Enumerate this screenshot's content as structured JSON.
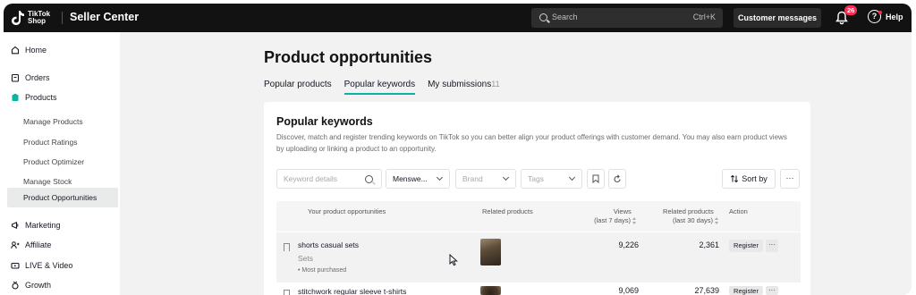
{
  "topbar": {
    "logo_text_line1": "TikTok",
    "logo_text_line2": "Shop",
    "app_title": "Seller Center",
    "search_placeholder": "Search",
    "search_shortcut": "Ctrl+K",
    "customer_messages_label": "Customer messages",
    "notification_count": "26",
    "help_label": "Help"
  },
  "sidebar": {
    "items": [
      {
        "label": "Home",
        "icon": "home-icon"
      },
      {
        "label": "Orders",
        "icon": "orders-icon"
      },
      {
        "label": "Products",
        "icon": "products-icon"
      },
      {
        "label": "Marketing",
        "icon": "marketing-icon"
      },
      {
        "label": "Affiliate",
        "icon": "affiliate-icon"
      },
      {
        "label": "LIVE & Video",
        "icon": "live-video-icon"
      },
      {
        "label": "Growth",
        "icon": "growth-icon"
      }
    ],
    "product_subitems": [
      "Manage Products",
      "Product Ratings",
      "Product Optimizer",
      "Manage Stock",
      "Product Opportunities"
    ],
    "active_subitem": "Product Opportunities"
  },
  "main": {
    "page_title": "Product opportunities",
    "tabs": [
      {
        "label": "Popular products",
        "count": ""
      },
      {
        "label": "Popular keywords",
        "count": ""
      },
      {
        "label": "My submissions",
        "count": "11"
      }
    ],
    "active_tab": "Popular keywords",
    "card": {
      "title": "Popular keywords",
      "description": "Discover, match and register trending keywords on TikTok so you can better align your product offerings with customer demand. You may also earn product views by uploading or linking a product to an opportunity."
    },
    "filters": {
      "keyword_placeholder": "Keyword details",
      "category_value": "Menswe...",
      "brand_placeholder": "Brand",
      "tags_placeholder": "Tags",
      "sort_label": "Sort by",
      "more_label": "···"
    },
    "table": {
      "headers": {
        "opportunities": "Your product opportunities",
        "related_products": "Related products",
        "views_line1": "Views",
        "views_line2": "(last 7 days)",
        "related_count_line1": "Related products",
        "related_count_line2": "(last 30 days)",
        "action": "Action"
      },
      "rows": [
        {
          "keyword": "shorts casual sets",
          "category": "Sets",
          "tag": "• Most purchased",
          "views": "9,226",
          "related": "2,361",
          "action": "Register",
          "more": "···"
        },
        {
          "keyword": "stitchwork regular sleeve t-shirts",
          "category": "",
          "tag": "",
          "views": "9,069",
          "related": "27,639",
          "action": "Register",
          "more": "···"
        }
      ]
    }
  },
  "colors": {
    "accent": "#0bb3a4",
    "topbar_bg": "#121212",
    "badge": "#fe2c55"
  }
}
